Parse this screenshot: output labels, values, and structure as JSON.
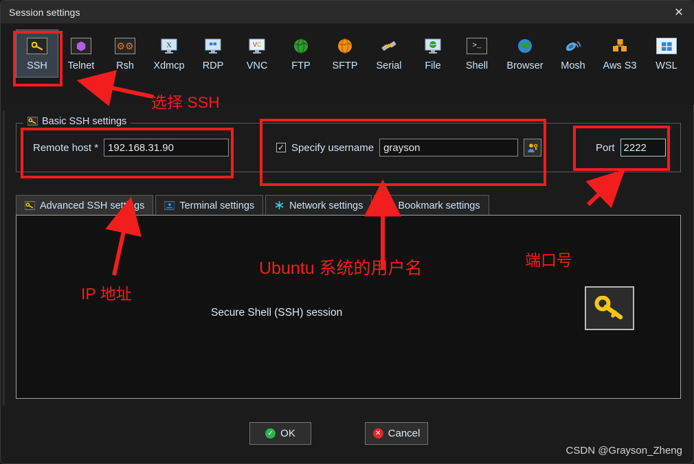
{
  "window": {
    "title": "Session settings",
    "close_icon": "close-icon"
  },
  "toolbar": {
    "protocols": [
      {
        "label": "SSH",
        "icon": "key-icon",
        "glyph": "🔑",
        "selected": true
      },
      {
        "label": "Telnet",
        "icon": "cube-icon",
        "glyph": "🔷",
        "selected": false
      },
      {
        "label": "Rsh",
        "icon": "gears-icon",
        "glyph": "⚙",
        "selected": false
      },
      {
        "label": "Xdmcp",
        "icon": "x-monitor-icon",
        "glyph": "🖥",
        "selected": false
      },
      {
        "label": "RDP",
        "icon": "windows-monitor-icon",
        "glyph": "🖥",
        "selected": false
      },
      {
        "label": "VNC",
        "icon": "vnc-monitor-icon",
        "glyph": "🖥",
        "selected": false
      },
      {
        "label": "FTP",
        "icon": "green-globe-icon",
        "glyph": "🌍",
        "selected": false
      },
      {
        "label": "SFTP",
        "icon": "orange-globe-icon",
        "glyph": "🌎",
        "selected": false
      },
      {
        "label": "Serial",
        "icon": "plug-icon",
        "glyph": "🔌",
        "selected": false
      },
      {
        "label": "File",
        "icon": "file-monitor-icon",
        "glyph": "🖥",
        "selected": false
      },
      {
        "label": "Shell",
        "icon": "terminal-icon",
        "glyph": ">",
        "selected": false
      },
      {
        "label": "Browser",
        "icon": "globe-icon",
        "glyph": "🌍",
        "selected": false
      },
      {
        "label": "Mosh",
        "icon": "satellite-icon",
        "glyph": "📡",
        "selected": false
      },
      {
        "label": "Aws S3",
        "icon": "aws-cubes-icon",
        "glyph": "📦",
        "selected": false
      },
      {
        "label": "WSL",
        "icon": "windows-icon",
        "glyph": "🪟",
        "selected": false
      }
    ]
  },
  "basic_settings": {
    "group_title": "Basic SSH settings",
    "group_icon": "key-icon",
    "remote_host_label": "Remote host *",
    "remote_host_value": "192.168.31.90",
    "specify_username_label": "Specify username",
    "specify_username_checked": true,
    "username_value": "grayson",
    "username_dropdown_icon": "chevron-down-icon",
    "user_picker_icon": "user-key-icon",
    "port_label": "Port",
    "port_value": "2222"
  },
  "tabs": [
    {
      "label": "Advanced SSH settings",
      "icon": "key-icon",
      "active": true
    },
    {
      "label": "Terminal settings",
      "icon": "terminal-icon",
      "active": false
    },
    {
      "label": "Network settings",
      "icon": "network-icon",
      "active": false
    },
    {
      "label": "Bookmark settings",
      "icon": "star-icon",
      "active": false
    }
  ],
  "content": {
    "session_caption": "Secure Shell (SSH) session",
    "session_icon": "key-icon"
  },
  "footer": {
    "ok_label": "OK",
    "ok_icon": "check-circle-icon",
    "cancel_label": "Cancel",
    "cancel_icon": "x-circle-icon",
    "watermark": "CSDN @Grayson_Zheng"
  },
  "annotations": {
    "color": "#f21d1d",
    "select_ssh": "选择 SSH",
    "ip_address": "IP 地址",
    "ubuntu_username": "Ubuntu 系统的用户名",
    "port_number": "端口号"
  }
}
